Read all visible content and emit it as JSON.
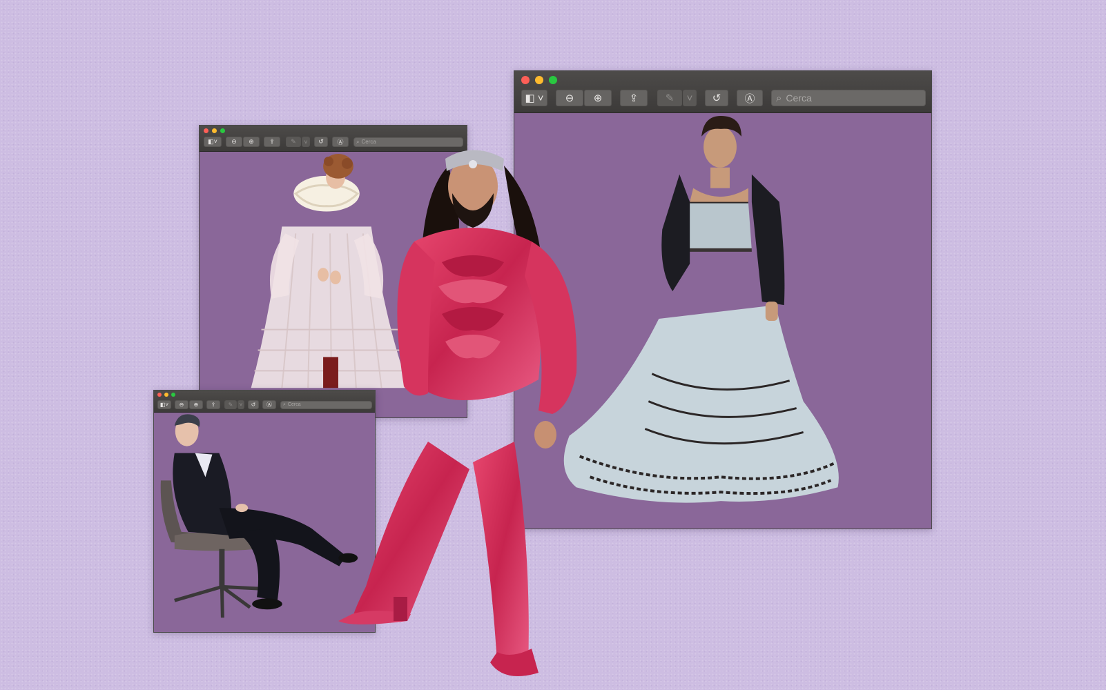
{
  "colors": {
    "background": "#cdbde2",
    "window_content": "#8a6799",
    "titlebar": "#4d4b49",
    "close": "#fd5f57",
    "minimize": "#febb2e",
    "zoom": "#29c840"
  },
  "windows": [
    {
      "id": "main",
      "search_placeholder": "Cerca",
      "toolbar_icons": [
        "sidebar-icon",
        "zoom-out-icon",
        "zoom-in-icon",
        "share-icon",
        "markup-pen-icon",
        "rotate-icon",
        "annotate-icon",
        "search-icon"
      ]
    },
    {
      "id": "medium",
      "search_placeholder": "Cerca"
    },
    {
      "id": "small",
      "search_placeholder": "Cerca"
    }
  ],
  "photos": {
    "main": "figure-in-ruffled-gown-and-black-blazer",
    "medium": "figure-in-ruff-collar-and-sheer-crinoline-dress",
    "small": "figure-in-black-suit-seated-on-chair",
    "center": "figure-in-pink-metallic-ruffled-suit"
  }
}
